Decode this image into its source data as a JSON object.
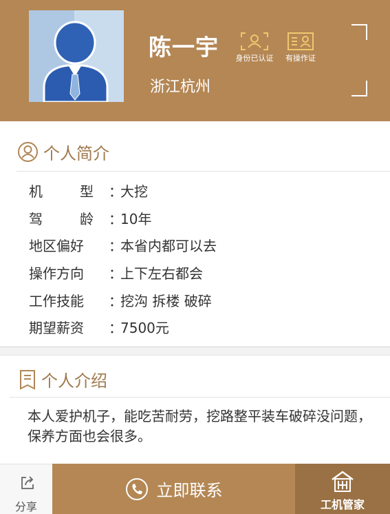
{
  "colors": {
    "brand": "#b48755",
    "brand_dark": "#9a7144",
    "accent_text": "#a07a4e"
  },
  "profile": {
    "name": "陈一宇",
    "city": "浙江杭州",
    "badges": [
      {
        "label": "身份已认证",
        "icon": "id-verified-icon"
      },
      {
        "label": "有操作证",
        "icon": "operator-license-icon"
      }
    ]
  },
  "intro_section": {
    "title": "个人简介",
    "rows": [
      {
        "label": "机型",
        "value": "大挖"
      },
      {
        "label": "驾龄",
        "value": "10年"
      },
      {
        "label": "地区偏好",
        "value": "本省内都可以去"
      },
      {
        "label": "操作方向",
        "value": "上下左右都会"
      },
      {
        "label": "工作技能",
        "value": "挖沟 拆楼 破碎"
      },
      {
        "label": "期望薪资",
        "value": "7500元"
      }
    ],
    "colon": "："
  },
  "bio_section": {
    "title": "个人介绍",
    "text": "本人爱护机子，能吃苦耐劳，挖路整平装车破碎没问题，保养方面也会很多。"
  },
  "bottom_bar": {
    "share_label": "分享",
    "contact_label": "立即联系",
    "brand_label": "工机管家"
  }
}
